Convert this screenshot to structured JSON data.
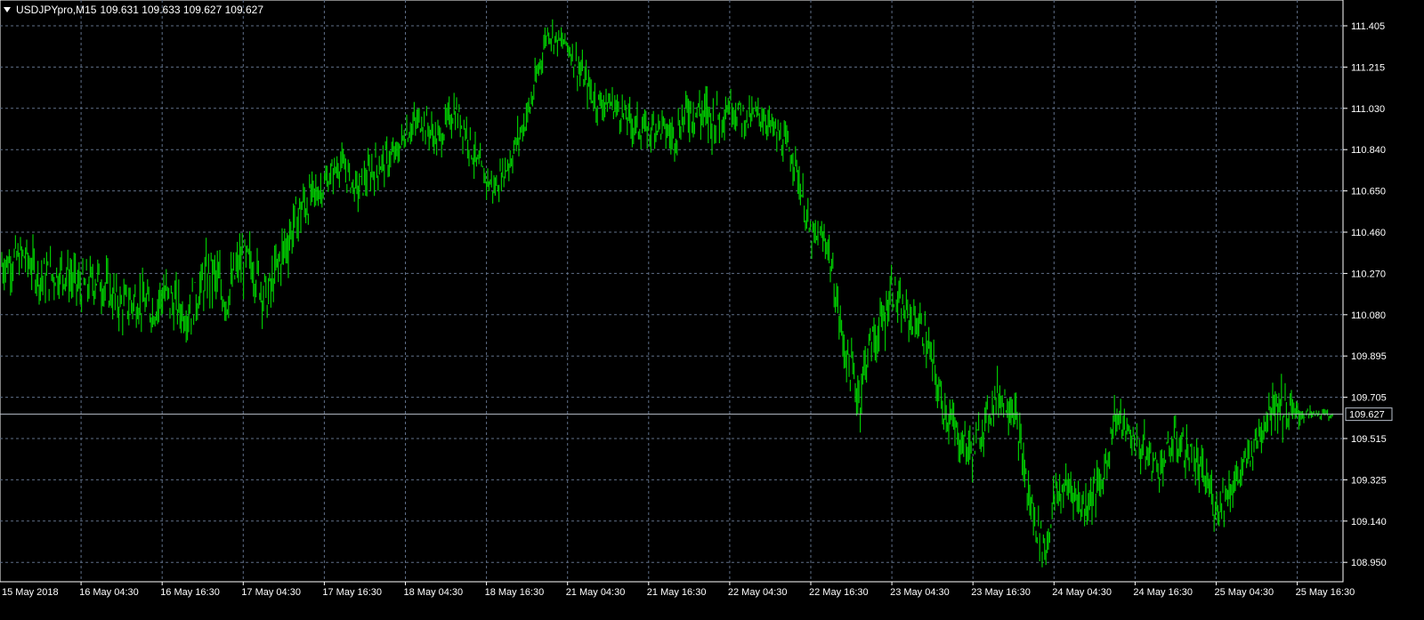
{
  "header": {
    "symbol_timeframe": "USDJPYpro,M15",
    "ohlc": "109.631 109.633 109.627 109.627"
  },
  "colors": {
    "background": "#000000",
    "grid": "#5f6f88",
    "candles": "#00c800",
    "axis_text": "#ffffff",
    "bid_line": "#b9c0cc"
  },
  "icons": {
    "symbol_menu": "triangle-down-icon"
  },
  "chart_data": {
    "type": "line",
    "title": "",
    "xlabel": "",
    "ylabel": "",
    "grid": true,
    "ylim": [
      108.9,
      111.5
    ],
    "y_ticks": [
      "111.405",
      "111.215",
      "111.030",
      "110.840",
      "110.650",
      "110.460",
      "110.270",
      "110.080",
      "109.895",
      "109.705",
      "109.515",
      "109.325",
      "109.140",
      "108.950"
    ],
    "x_ticks": [
      "15 May 2018",
      "16 May 04:30",
      "16 May 16:30",
      "17 May 04:30",
      "17 May 16:30",
      "18 May 04:30",
      "18 May 16:30",
      "21 May 04:30",
      "21 May 16:30",
      "22 May 04:30",
      "22 May 16:30",
      "23 May 04:30",
      "23 May 16:30",
      "24 May 04:30",
      "24 May 16:30",
      "25 May 04:30",
      "25 May 16:30"
    ],
    "current_price": 109.627,
    "current_price_label": "109.627",
    "series": [
      {
        "x": [
          0,
          0.3,
          0.5,
          0.8,
          1.0,
          1.2,
          1.5,
          1.7,
          1.9,
          2.0,
          2.3,
          2.6,
          2.8,
          2.95,
          3.1,
          3.3,
          3.45,
          3.7,
          4.0,
          4.2,
          4.4,
          4.6,
          4.9,
          5.0,
          5.2,
          5.4,
          5.6,
          5.75,
          5.9,
          6.1,
          6.3,
          6.55,
          6.75,
          6.9,
          7.0,
          7.15,
          7.35,
          7.55,
          7.8,
          8.0,
          8.1,
          8.3,
          8.5,
          8.8,
          9.0,
          9.2,
          9.4,
          9.6,
          9.8,
          10.0,
          10.2,
          10.4,
          10.6,
          10.7,
          10.9,
          11.0,
          11.1,
          11.3,
          11.4,
          11.6,
          11.8,
          12.0,
          12.1,
          12.3,
          12.5,
          12.7,
          12.9,
          13.0,
          13.2,
          13.35,
          13.6,
          13.75,
          13.9,
          14.0,
          14.1,
          14.3,
          14.5,
          14.7,
          14.9,
          15.0,
          15.3,
          15.4,
          15.55,
          15.7,
          15.9,
          16.1,
          16.3,
          16.4,
          16.45
        ],
        "values": [
          110.31,
          110.35,
          110.25,
          110.28,
          110.2,
          110.25,
          110.12,
          110.15,
          110.1,
          110.18,
          110.08,
          110.28,
          110.15,
          110.32,
          110.32,
          110.15,
          110.33,
          110.56,
          110.68,
          110.78,
          110.65,
          110.75,
          110.82,
          110.92,
          110.98,
          110.88,
          111.02,
          110.93,
          110.75,
          110.66,
          110.8,
          111.05,
          111.38,
          111.33,
          111.32,
          111.2,
          111.06,
          111.05,
          110.96,
          110.92,
          110.96,
          110.9,
          111.03,
          110.98,
          111.05,
          110.98,
          111.0,
          110.9,
          110.8,
          110.43,
          110.42,
          109.95,
          109.7,
          109.92,
          110.05,
          110.22,
          110.1,
          110.05,
          110.0,
          109.7,
          109.53,
          109.45,
          109.55,
          109.72,
          109.66,
          109.22,
          109.0,
          109.25,
          109.3,
          109.2,
          109.32,
          109.62,
          109.55,
          109.5,
          109.46,
          109.38,
          109.51,
          109.42,
          109.3,
          109.2,
          109.35,
          109.43,
          109.55,
          109.7,
          109.63,
          109.627,
          109.627,
          109.627,
          109.627
        ],
        "highs": [
          110.43,
          110.44,
          110.37,
          110.4,
          110.31,
          110.38,
          110.25,
          110.29,
          110.22,
          110.33,
          110.2,
          110.45,
          110.3,
          110.45,
          110.46,
          110.3,
          110.46,
          110.76,
          110.75,
          110.85,
          110.75,
          110.84,
          110.9,
          111.0,
          111.05,
          110.96,
          111.1,
          111.02,
          110.84,
          110.74,
          110.88,
          111.14,
          111.42,
          111.4,
          111.38,
          111.28,
          111.14,
          111.12,
          111.05,
          111.0,
          111.04,
          110.98,
          111.18,
          111.05,
          111.12,
          111.06,
          111.07,
          110.98,
          110.88,
          110.52,
          110.5,
          110.05,
          109.8,
          110.02,
          110.14,
          110.32,
          110.2,
          110.13,
          110.1,
          109.8,
          109.64,
          109.54,
          109.64,
          109.8,
          109.75,
          109.35,
          109.1,
          109.33,
          109.38,
          109.3,
          109.4,
          109.72,
          109.63,
          109.58,
          109.56,
          109.46,
          109.62,
          109.53,
          109.4,
          109.32,
          109.43,
          109.52,
          109.63,
          109.83,
          109.74,
          109.66,
          109.65,
          109.65,
          109.64
        ],
        "lows": [
          110.2,
          110.25,
          110.15,
          110.18,
          110.1,
          110.15,
          110.05,
          110.06,
          110.02,
          110.07,
          110.0,
          110.17,
          110.05,
          110.22,
          110.22,
          110.05,
          110.22,
          110.48,
          110.6,
          110.7,
          110.58,
          110.66,
          110.74,
          110.83,
          110.9,
          110.8,
          110.93,
          110.84,
          110.65,
          110.6,
          110.72,
          110.96,
          111.3,
          111.26,
          111.25,
          111.12,
          110.98,
          110.97,
          110.88,
          110.84,
          110.88,
          110.8,
          110.95,
          110.8,
          110.96,
          110.9,
          110.92,
          110.82,
          110.7,
          110.35,
          110.34,
          109.85,
          109.55,
          109.8,
          109.9,
          110.12,
          110.0,
          109.96,
          109.9,
          109.6,
          109.42,
          109.33,
          109.45,
          109.62,
          109.55,
          109.1,
          108.92,
          109.15,
          109.2,
          109.12,
          109.22,
          109.52,
          109.48,
          109.42,
          109.36,
          109.3,
          109.42,
          109.33,
          109.2,
          109.12,
          109.27,
          109.35,
          109.47,
          109.58,
          109.55,
          109.6,
          109.61,
          109.6,
          109.61
        ]
      }
    ]
  }
}
